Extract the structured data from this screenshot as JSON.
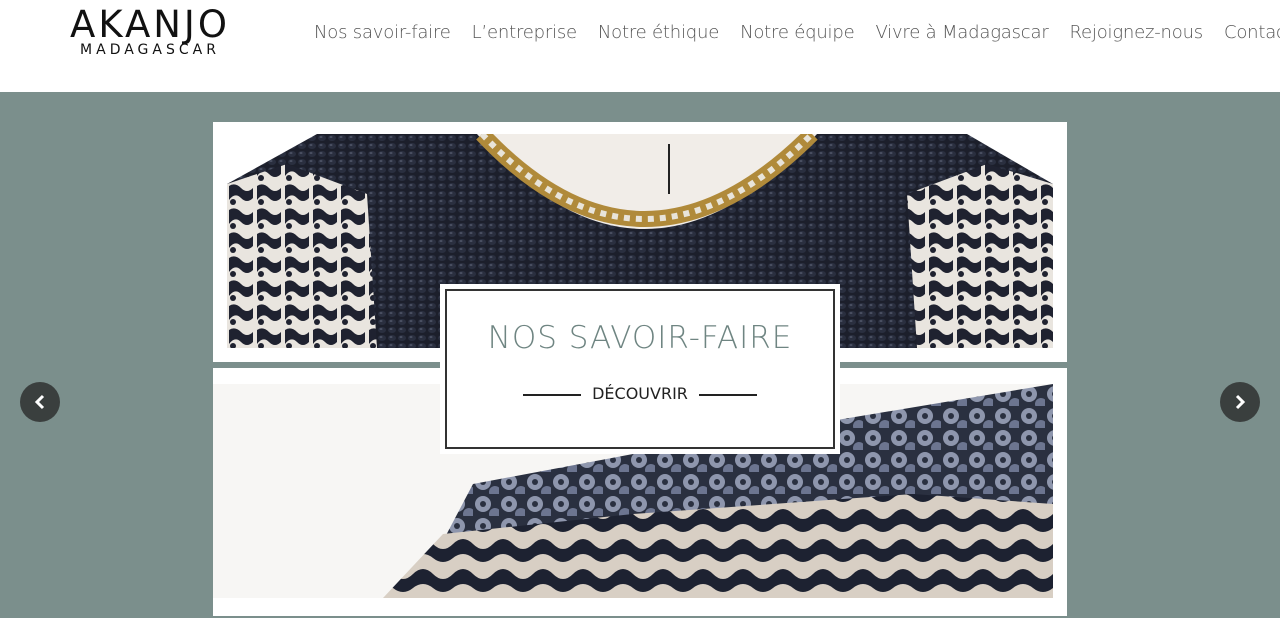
{
  "logo": {
    "main": "AKANJO",
    "sub": "MADAGASCAR"
  },
  "nav": {
    "items": [
      {
        "label": "Nos savoir-faire"
      },
      {
        "label": "L’entreprise"
      },
      {
        "label": "Notre éthique"
      },
      {
        "label": "Notre équipe"
      },
      {
        "label": "Vivre à Madagascar"
      },
      {
        "label": "Rejoignez-nous"
      },
      {
        "label": "Contact"
      }
    ]
  },
  "slider": {
    "title": "NOS SAVOIR-FAIRE",
    "cta_label": "DÉCOUVRIR",
    "prev_icon": "chevron-left-icon",
    "next_icon": "chevron-right-icon"
  },
  "colors": {
    "hero_bg": "#7b8f8c",
    "title": "#6f8582",
    "arrow_bg": "#3a3f3e"
  }
}
